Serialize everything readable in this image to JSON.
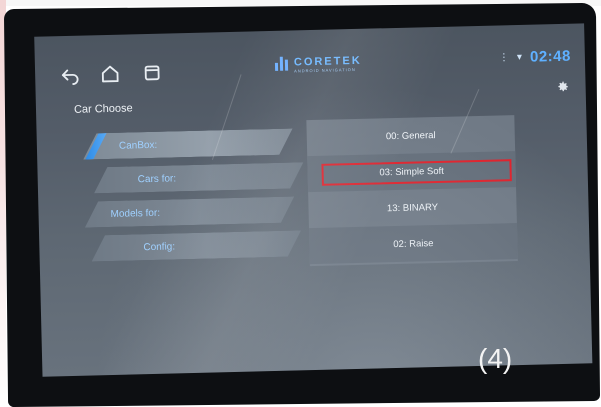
{
  "statusbar": {
    "nav": [
      {
        "name": "back-icon"
      },
      {
        "name": "home-icon"
      },
      {
        "name": "recent-apps-icon"
      }
    ],
    "brand": {
      "name": "CORETEK",
      "tagline": "ANDROID NAVIGATION"
    },
    "clock": "02:48",
    "status_icons": [
      "signal-icon",
      "wifi-icon"
    ]
  },
  "page": {
    "title": "Car Choose"
  },
  "menu": {
    "items": [
      {
        "label": "CanBox:"
      },
      {
        "label": "Cars for:"
      },
      {
        "label": "Models for:"
      },
      {
        "label": "Config:"
      }
    ]
  },
  "list": {
    "items": [
      {
        "label": "00: General"
      },
      {
        "label": "03: Simple Soft"
      },
      {
        "label": "13: BINARY"
      },
      {
        "label": "02: Raise"
      }
    ],
    "highlighted_index": 1,
    "highlight_color": "#e0202a"
  },
  "overlay": {
    "step": "(4)"
  },
  "colors": {
    "accent": "#2d8be6",
    "clock": "#5fb0ff",
    "menu_text": "#9fd0ff"
  }
}
